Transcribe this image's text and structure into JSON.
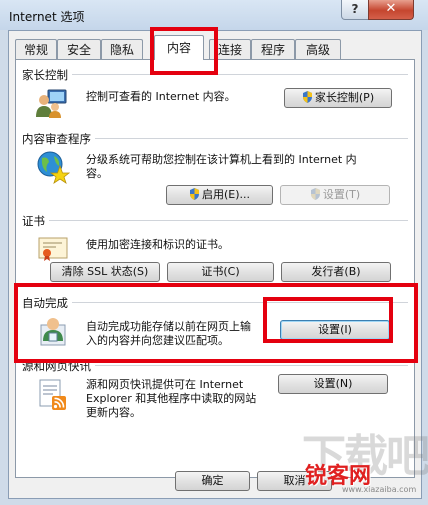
{
  "window": {
    "title": "Internet 选项",
    "help_glyph": "?",
    "close_glyph": "✕"
  },
  "tabs": [
    {
      "label": "常规"
    },
    {
      "label": "安全"
    },
    {
      "label": "隐私"
    },
    {
      "label": "内容",
      "active": true
    },
    {
      "label": "连接"
    },
    {
      "label": "程序"
    },
    {
      "label": "高级"
    }
  ],
  "groups": {
    "parental": {
      "title": "家长控制",
      "description": "控制可查看的 Internet 内容。",
      "button": "家长控制(P)",
      "icon": "parental-control-icon"
    },
    "content_advisor": {
      "title": "内容审查程序",
      "description_line1": "分级系统可帮助您控制在该计算机上看到的 Internet 内",
      "description_line2": "容。",
      "enable_button": "启用(E)...",
      "settings_button": "设置(T)",
      "icon": "globe-star-icon"
    },
    "certificates": {
      "title": "证书",
      "description": "使用加密连接和标识的证书。",
      "clear_ssl_button": "清除 SSL 状态(S)",
      "certificates_button": "证书(C)",
      "publishers_button": "发行者(B)",
      "icon": "certificate-icon"
    },
    "autocomplete": {
      "title": "自动完成",
      "description_line1": "自动完成功能存储以前在网页上输",
      "description_line2": "入的内容并向您建议匹配项。",
      "settings_button": "设置(I)",
      "icon": "autocomplete-icon"
    },
    "feeds": {
      "title": "源和网页快讯",
      "description_line1": "源和网页快讯提供可在 Internet",
      "description_line2": "Explorer 和其他程序中读取的网站",
      "description_line3": "更新内容。",
      "settings_button": "设置(N)",
      "icon": "feeds-icon"
    }
  },
  "footer": {
    "ok_button": "确定",
    "cancel_button": "取消"
  },
  "watermark": {
    "gray_text": "下载吧",
    "red_text": "锐客网",
    "url_text": "www.xiazaiba.com"
  },
  "highlight_color": "#e4000f"
}
